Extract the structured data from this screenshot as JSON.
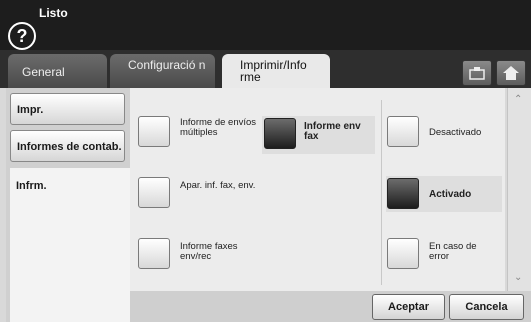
{
  "header": {
    "help_symbol": "?",
    "status": "Listo"
  },
  "tabs": [
    {
      "label": "General",
      "active": false
    },
    {
      "label": "Configuració n",
      "active": false
    },
    {
      "label": "Imprimir/Info rme",
      "active": true
    }
  ],
  "toolbar_icons": [
    "copy-icon",
    "home-icon"
  ],
  "sidebar": {
    "items": [
      {
        "label": "Impr.",
        "active": false
      },
      {
        "label": "Informes de contab.",
        "active": false
      },
      {
        "label": "Infrm.",
        "active": true
      }
    ]
  },
  "reports": [
    {
      "label": "Informe de envíos múltiples",
      "checked": false
    },
    {
      "label": "Informe env fax",
      "checked": true
    },
    {
      "label": "Apar. inf. fax, env.",
      "checked": false
    },
    {
      "label": "Informe faxes env/rec",
      "checked": false
    }
  ],
  "options": [
    {
      "label": "Desactivado",
      "checked": false
    },
    {
      "label": "Activado",
      "checked": true
    },
    {
      "label": "En caso de error",
      "checked": false
    }
  ],
  "scrollbar": {
    "up": "⌃",
    "down": "⌄"
  },
  "footer": {
    "accept": "Aceptar",
    "cancel": "Cancela"
  },
  "colors": {
    "topbar": "#1d1d1d",
    "tabbar": "#2e2e2e",
    "panel": "#ececec",
    "checked": "#2a2a2a"
  }
}
